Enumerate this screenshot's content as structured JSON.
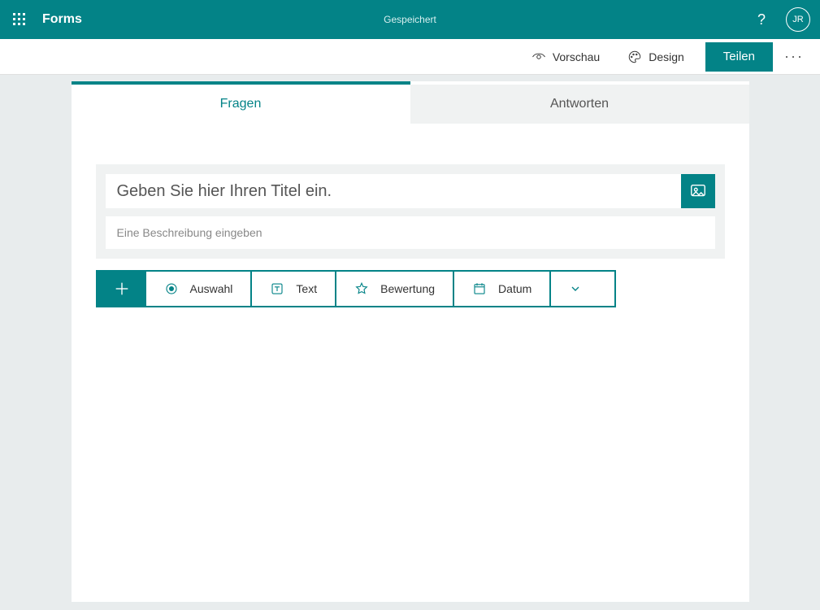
{
  "brand": {
    "teal": "#038387"
  },
  "header": {
    "app_name": "Forms",
    "saved_label": "Gespeichert",
    "user_initials": "JR"
  },
  "toolbar": {
    "preview_label": "Vorschau",
    "design_label": "Design",
    "share_label": "Teilen"
  },
  "tabs": {
    "questions": "Fragen",
    "answers": "Antworten"
  },
  "form": {
    "title_placeholder": "Geben Sie hier Ihren Titel ein.",
    "description_placeholder": "Eine Beschreibung eingeben"
  },
  "question_types": {
    "choice": "Auswahl",
    "text": "Text",
    "rating": "Bewertung",
    "date": "Datum"
  }
}
